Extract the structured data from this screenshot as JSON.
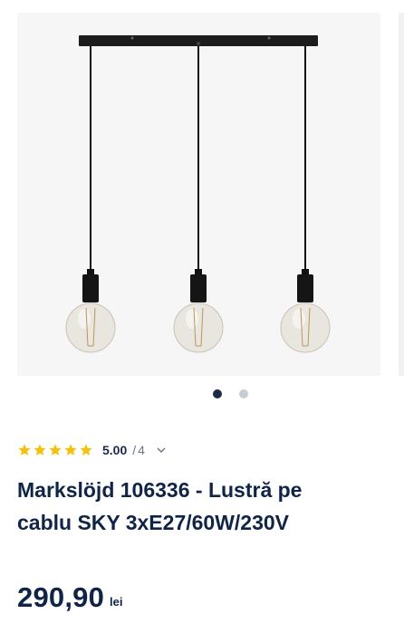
{
  "product": {
    "title_line1": "Markslöjd 106336 - Lustră pe",
    "title_line2": "cablu SKY 3xE27/60W/230V",
    "image": {
      "alt": "Lustră pe cablu cu 3 becuri",
      "current_index": 1,
      "total_images": 2
    }
  },
  "rating": {
    "score": "5.00",
    "separator": "/",
    "count": "4",
    "stars_filled": 5,
    "stars_total": 5,
    "star_color": "#f4c20d"
  },
  "price": {
    "value": "290,90",
    "currency": "lei"
  },
  "colors": {
    "text": "#102448",
    "active_dot": "#1b2a48",
    "inactive_dot": "#c6ccd6"
  }
}
